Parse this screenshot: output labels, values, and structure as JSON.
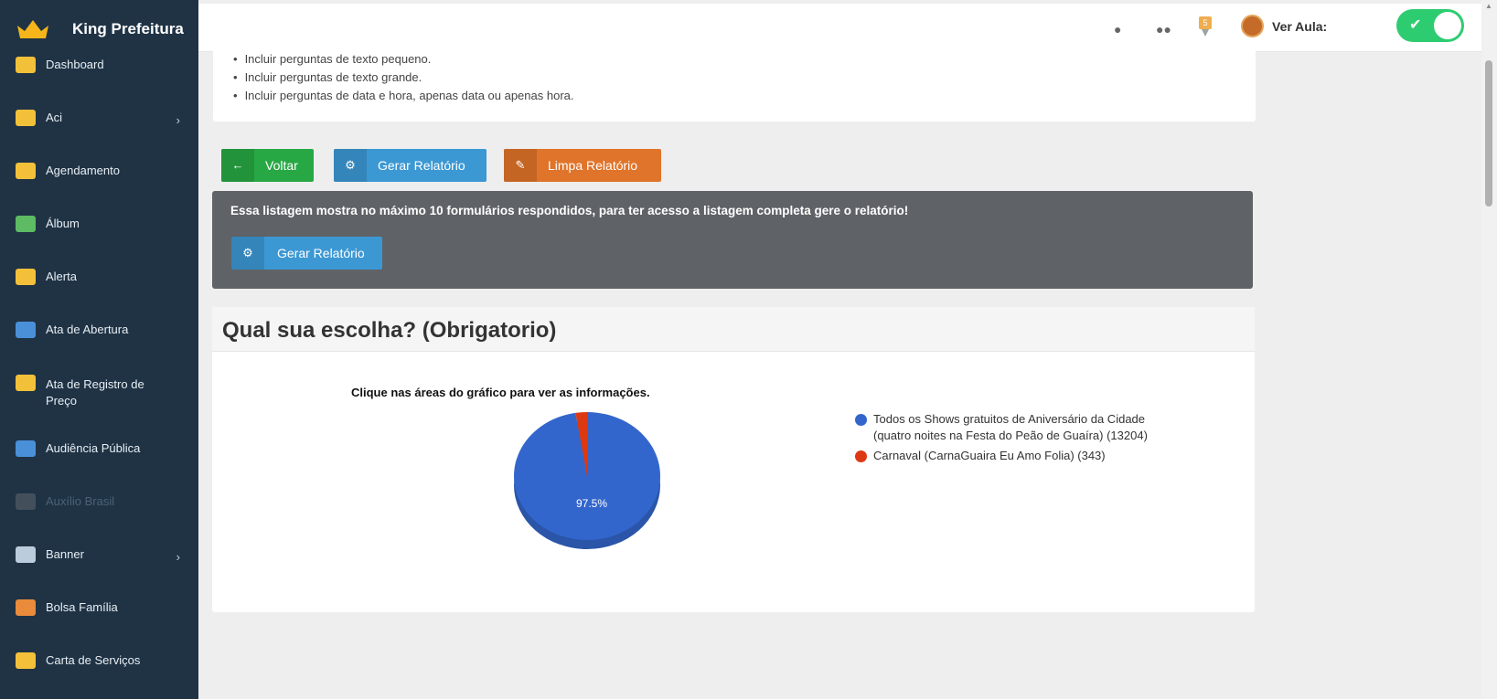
{
  "app": {
    "title": "King Prefeitura"
  },
  "sidebar": {
    "items": [
      {
        "label": "Dashboard",
        "icon": "dashboard-icon",
        "has_submenu": false,
        "enabled": true
      },
      {
        "label": "Aci",
        "icon": "shield-icon",
        "has_submenu": true,
        "enabled": true
      },
      {
        "label": "Agendamento",
        "icon": "calendar-icon",
        "has_submenu": false,
        "enabled": true
      },
      {
        "label": "Álbum",
        "icon": "image-icon",
        "has_submenu": false,
        "enabled": true
      },
      {
        "label": "Alerta",
        "icon": "alert-icon",
        "has_submenu": false,
        "enabled": true
      },
      {
        "label": "Ata de Abertura",
        "icon": "document-icon",
        "has_submenu": false,
        "enabled": true
      },
      {
        "label": "Ata de Registro de Preço",
        "icon": "coin-icon",
        "has_submenu": false,
        "enabled": true
      },
      {
        "label": "Audiência Pública",
        "icon": "presentation-icon",
        "has_submenu": false,
        "enabled": true
      },
      {
        "label": "Auxílio Brasil",
        "icon": "chart-icon",
        "has_submenu": false,
        "enabled": false
      },
      {
        "label": "Banner",
        "icon": "banner-icon",
        "has_submenu": true,
        "enabled": true
      },
      {
        "label": "Bolsa Família",
        "icon": "family-icon",
        "has_submenu": false,
        "enabled": true
      },
      {
        "label": "Carta de Serviços",
        "icon": "folder-icon",
        "has_submenu": false,
        "enabled": true
      }
    ]
  },
  "topbar": {
    "icons": [
      "paw-icon",
      "users-icon"
    ],
    "notification_count": "5",
    "ver_aula_label": "Ver Aula:",
    "ver_aula_enabled": true
  },
  "instructions": [
    "Incluir perguntas de texto pequeno.",
    "Incluir perguntas de texto grande.",
    "Incluir perguntas de data e hora, apenas data ou apenas hora."
  ],
  "actions": {
    "voltar": "Voltar",
    "gerar_relatorio": "Gerar Relatório",
    "limpa_relatorio": "Limpa Relatório"
  },
  "notice": {
    "text": "Essa listagem mostra no máximo 10 formulários respondidos, para ter acesso a listagem completa gere o relatório!",
    "button": "Gerar Relatório"
  },
  "question": {
    "title": "Qual sua escolha? (Obrigatorio)",
    "caption": "Clique nas áreas do gráfico para ver as informações."
  },
  "chart_data": {
    "type": "pie",
    "title": "Clique nas áreas do gráfico para ver as informações.",
    "slices": [
      {
        "label": "Todos os Shows gratuitos de Aniversário da Cidade (quatro noites na Festa do Peão de Guaíra) (13204)",
        "value": 13204,
        "color": "#3366cc"
      },
      {
        "label": "Carnaval (CarnaGuaira Eu Amo Folia) (343)",
        "value": 343,
        "color": "#dc3912"
      }
    ],
    "data_label": "97.5%",
    "legend_position": "right"
  }
}
